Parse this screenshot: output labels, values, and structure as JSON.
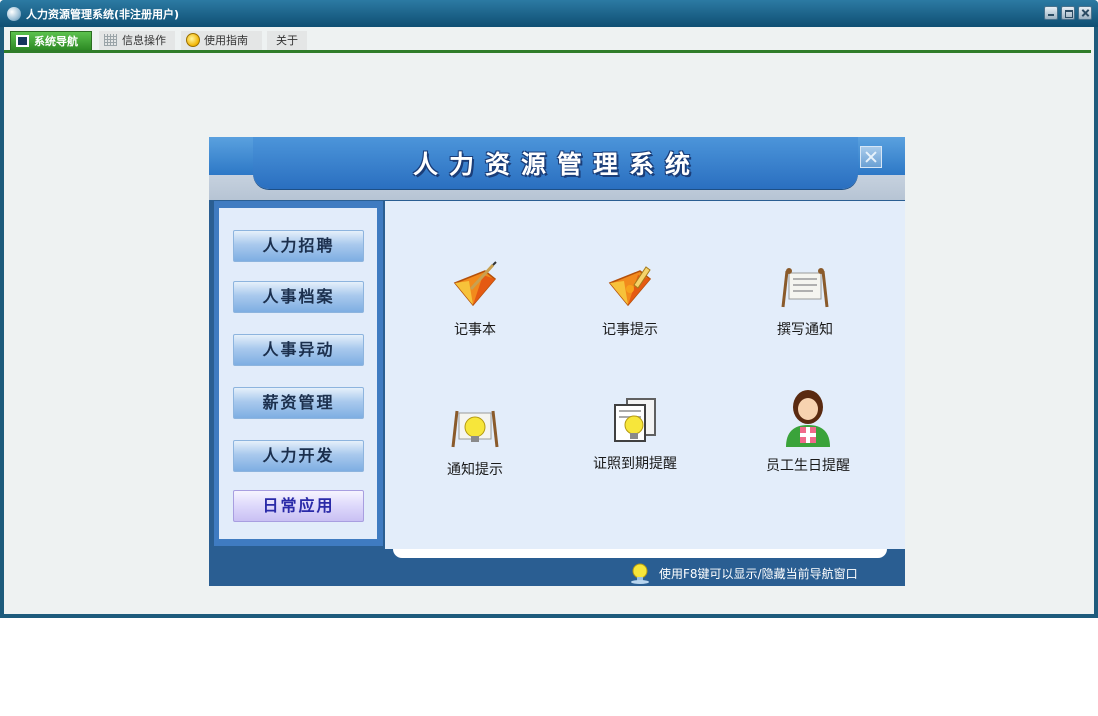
{
  "window": {
    "title": "人力资源管理系统(非注册用户)"
  },
  "tabs": [
    {
      "label": "系统导航",
      "icon": "monitor-icon"
    },
    {
      "label": "信息操作",
      "icon": "grid-icon"
    },
    {
      "label": "使用指南",
      "icon": "smiley-icon"
    },
    {
      "label": "关于"
    }
  ],
  "dialog": {
    "title": "人力资源管理系统"
  },
  "sidebar": {
    "items": [
      {
        "label": "人力招聘"
      },
      {
        "label": "人事档案"
      },
      {
        "label": "人事异动"
      },
      {
        "label": "薪资管理"
      },
      {
        "label": "人力开发"
      },
      {
        "label": "日常应用",
        "active": true
      }
    ]
  },
  "apps": [
    {
      "label": "记事本",
      "icon": "notebook-pencil-icon"
    },
    {
      "label": "记事提示",
      "icon": "notebook-brush-icon"
    },
    {
      "label": "撰写通知",
      "icon": "notice-board-icon"
    },
    {
      "label": "通知提示",
      "icon": "notice-bulb-icon"
    },
    {
      "label": "证照到期提醒",
      "icon": "certificate-bulb-icon"
    },
    {
      "label": "员工生日提醒",
      "icon": "birthday-person-icon"
    }
  ],
  "footer": {
    "tip": "使用F8键可以显示/隐藏当前导航窗口"
  },
  "colors": {
    "title_bar": "#145a80",
    "active_tab": "#3a9c30",
    "panel_blue": "#2a5e92",
    "content_bg": "#e3edfa"
  }
}
